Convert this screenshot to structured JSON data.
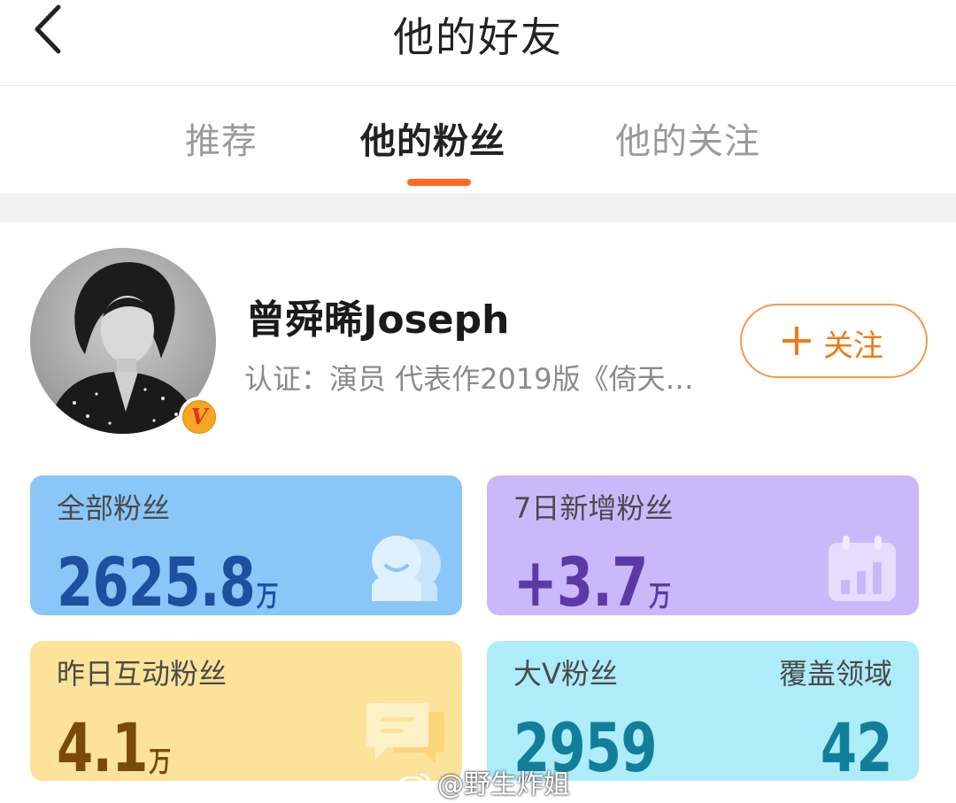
{
  "header": {
    "title": "他的好友",
    "back_icon": "chevron-left-icon"
  },
  "tabs": [
    {
      "label": "推荐",
      "active": false
    },
    {
      "label": "他的粉丝",
      "active": true
    },
    {
      "label": "他的关注",
      "active": false
    }
  ],
  "colors": {
    "accent": "#ff6a1f",
    "follow": "#f07a16"
  },
  "profile": {
    "name": "曾舜晞Joseph",
    "verification": "认证：演员 代表作2019版《倚天…",
    "badge_icon": "verified-v-badge-icon",
    "follow_label": "关注"
  },
  "stats": {
    "all_fans": {
      "label": "全部粉丝",
      "value": "2625.8",
      "unit": "万",
      "icon": "fans-faces-icon",
      "color": "#8ac6f8",
      "value_color": "#1e4fa0"
    },
    "new_fans": {
      "label": "7日新增粉丝",
      "value": "+3.7",
      "unit": "万",
      "icon": "calendar-chart-icon",
      "color": "#cbb8fb",
      "value_color": "#5b3aa6"
    },
    "active_fans": {
      "label": "昨日互动粉丝",
      "value": "4.1",
      "unit": "万",
      "icon": "chat-bubble-icon",
      "color": "#fde39a",
      "value_color": "#7a4a0a"
    },
    "bigv_fans": {
      "label": "大V粉丝",
      "value": "2959",
      "domain_label": "覆盖领域",
      "domain_value": "42",
      "color": "#aeecfa",
      "value_color": "#127f9a"
    }
  },
  "watermark": "@野生炸姐"
}
